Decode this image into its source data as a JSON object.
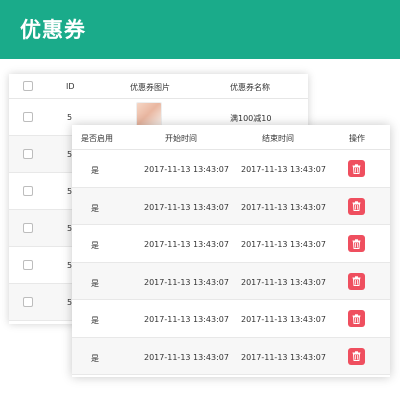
{
  "page": {
    "title": "优惠券"
  },
  "back_table": {
    "headers": {
      "id": "ID",
      "image": "优惠券图片",
      "name": "优惠券名称"
    },
    "rows": [
      {
        "id": "5",
        "name": "满100减10"
      },
      {
        "id": "5",
        "name": ""
      },
      {
        "id": "5",
        "name": ""
      },
      {
        "id": "5",
        "name": ""
      },
      {
        "id": "5",
        "name": ""
      },
      {
        "id": "5",
        "name": ""
      }
    ]
  },
  "front_table": {
    "headers": {
      "enabled": "是否启用",
      "start": "开始时间",
      "end": "结束时间",
      "action": "操作"
    },
    "rows": [
      {
        "enabled": "是",
        "start": "2017-11-13 13:43:07",
        "end": "2017-11-13 13:43:07"
      },
      {
        "enabled": "是",
        "start": "2017-11-13 13:43:07",
        "end": "2017-11-13 13:43:07"
      },
      {
        "enabled": "是",
        "start": "2017-11-13 13:43:07",
        "end": "2017-11-13 13:43:07"
      },
      {
        "enabled": "是",
        "start": "2017-11-13 13:43:07",
        "end": "2017-11-13 13:43:07"
      },
      {
        "enabled": "是",
        "start": "2017-11-13 13:43:07",
        "end": "2017-11-13 13:43:07"
      },
      {
        "enabled": "是",
        "start": "2017-11-13 13:43:07",
        "end": "2017-11-13 13:43:07"
      }
    ],
    "delete_icon": "trash-icon"
  },
  "colors": {
    "header": "#1aab8a",
    "delete": "#ef4f5f"
  }
}
